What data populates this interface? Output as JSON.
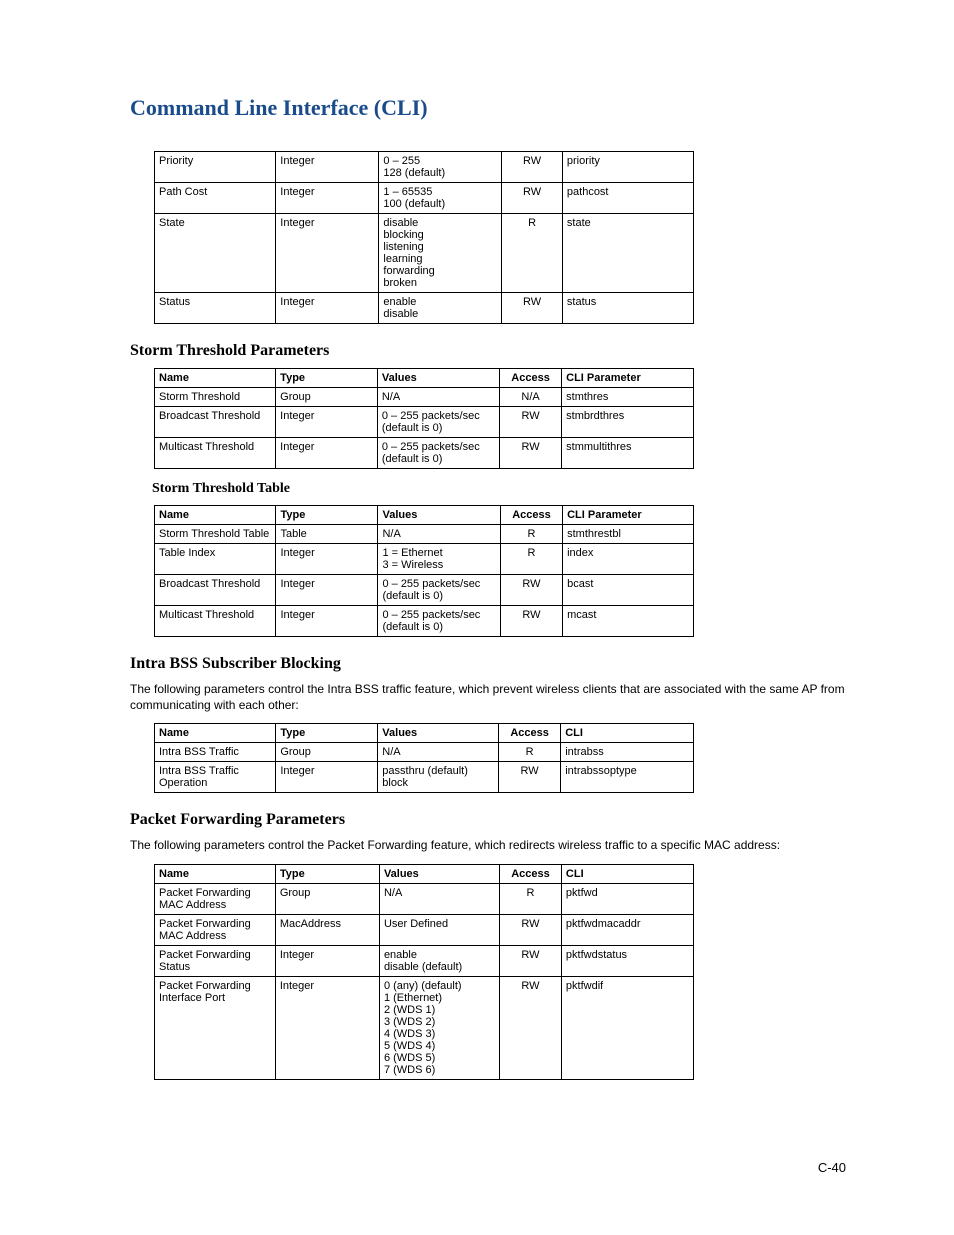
{
  "doc_title": "Command Line Interface (CLI)",
  "page_number": "C-40",
  "table_headers": {
    "name": "Name",
    "type": "Type",
    "values": "Values",
    "access": "Access",
    "cli_param": "CLI Parameter",
    "cli": "CLI"
  },
  "top_table": {
    "rows": [
      {
        "name": "Priority",
        "type": "Integer",
        "values": "0 – 255\n128 (default)",
        "access": "RW",
        "cli": "priority"
      },
      {
        "name": "Path Cost",
        "type": "Integer",
        "values": "1 – 65535\n100 (default)",
        "access": "RW",
        "cli": "pathcost"
      },
      {
        "name": "State",
        "type": "Integer",
        "values": "disable\nblocking\nlistening\nlearning\nforwarding\nbroken",
        "access": "R",
        "cli": "state"
      },
      {
        "name": "Status",
        "type": "Integer",
        "values": "enable\ndisable",
        "access": "RW",
        "cli": "status"
      }
    ]
  },
  "storm_params": {
    "title": "Storm Threshold Parameters",
    "rows": [
      {
        "name": "Storm Threshold",
        "type": "Group",
        "values": "N/A",
        "access": "N/A",
        "cli": "stmthres"
      },
      {
        "name": "Broadcast Threshold",
        "type": "Integer",
        "values": "0 – 255 packets/sec\n(default is 0)",
        "access": "RW",
        "cli": "stmbrdthres"
      },
      {
        "name": "Multicast Threshold",
        "type": "Integer",
        "values": "0 – 255 packets/sec\n(default is 0)",
        "access": "RW",
        "cli": "stmmultithres"
      }
    ]
  },
  "storm_table": {
    "title": "Storm Threshold Table",
    "rows": [
      {
        "name": "Storm Threshold Table",
        "type": "Table",
        "values": "N/A",
        "access": "R",
        "cli": "stmthrestbl"
      },
      {
        "name": "Table Index",
        "type": "Integer",
        "values": "1 = Ethernet\n3 = Wireless",
        "access": "R",
        "cli": "index"
      },
      {
        "name": "Broadcast Threshold",
        "type": "Integer",
        "values": "0 – 255 packets/sec\n(default is 0)",
        "access": "RW",
        "cli": "bcast"
      },
      {
        "name": "Multicast Threshold",
        "type": "Integer",
        "values": "0 – 255 packets/sec\n(default is 0)",
        "access": "RW",
        "cli": "mcast"
      }
    ]
  },
  "intra_bss": {
    "title": "Intra BSS Subscriber Blocking",
    "paragraph": "The following parameters control the Intra BSS traffic feature, which prevent wireless clients that are associated with the same AP from communicating with each other:",
    "rows": [
      {
        "name": "Intra BSS Traffic",
        "type": "Group",
        "values": "N/A",
        "access": "R",
        "cli": "intrabss"
      },
      {
        "name": "Intra BSS Traffic Operation",
        "type": "Integer",
        "values": "passthru (default)\nblock",
        "access": "RW",
        "cli": "intrabssoptype"
      }
    ]
  },
  "packet_fwd": {
    "title": "Packet Forwarding Parameters",
    "paragraph": "The following parameters control the Packet Forwarding feature, which redirects wireless traffic to a specific MAC address:",
    "rows": [
      {
        "name": "Packet Forwarding MAC Address",
        "type": "Group",
        "values": "N/A",
        "access": "R",
        "cli": "pktfwd"
      },
      {
        "name": "Packet Forwarding MAC Address",
        "type": "MacAddress",
        "values": "User Defined",
        "access": "RW",
        "cli": "pktfwdmacaddr"
      },
      {
        "name": "Packet Forwarding Status",
        "type": "Integer",
        "values": "enable\ndisable (default)",
        "access": "RW",
        "cli": "pktfwdstatus"
      },
      {
        "name": "Packet Forwarding Interface Port",
        "type": "Integer",
        "values": "0 (any) (default)\n1 (Ethernet)\n2 (WDS 1)\n3 (WDS 2)\n4 (WDS 3)\n5 (WDS 4)\n6 (WDS 5)\n7 (WDS 6)",
        "access": "RW",
        "cli": "pktfwdif"
      }
    ]
  }
}
